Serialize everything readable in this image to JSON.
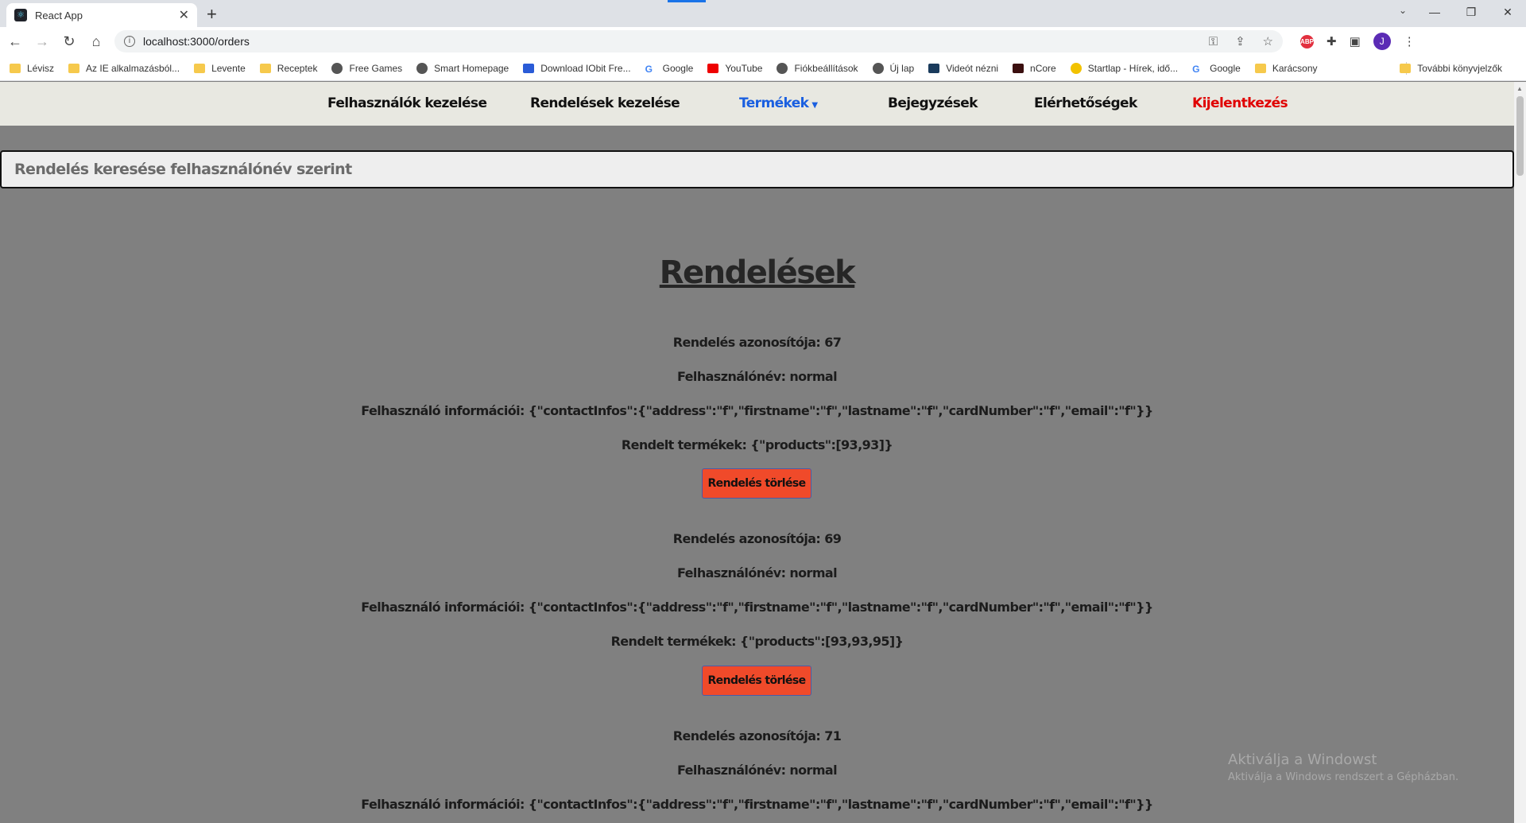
{
  "browser": {
    "tab_title": "React App",
    "tab_favicon": "react-icon",
    "url": "localhost:3000/orders",
    "bookmarks": [
      {
        "label": "Lévisz",
        "icon": "folder"
      },
      {
        "label": "Az IE alkalmazásból...",
        "icon": "folder"
      },
      {
        "label": "Levente",
        "icon": "folder"
      },
      {
        "label": "Receptek",
        "icon": "folder"
      },
      {
        "label": "Free Games",
        "icon": "globe"
      },
      {
        "label": "Smart Homepage",
        "icon": "globe"
      },
      {
        "label": "Download IObit Fre...",
        "icon": "blue"
      },
      {
        "label": "Google",
        "icon": "google"
      },
      {
        "label": "YouTube",
        "icon": "yt"
      },
      {
        "label": "Fiókbeállítások",
        "icon": "globe"
      },
      {
        "label": "Új lap",
        "icon": "globe"
      },
      {
        "label": "Videót nézni",
        "icon": "yah"
      },
      {
        "label": "nCore",
        "icon": "ncore"
      },
      {
        "label": "Startlap - Hírek, idő...",
        "icon": "start"
      },
      {
        "label": "Google",
        "icon": "google"
      },
      {
        "label": "Karácsony",
        "icon": "folder"
      }
    ],
    "other_bookmarks": "További könyvjelzők",
    "avatar_letter": "J"
  },
  "nav": {
    "users": "Felhasználók kezelése",
    "orders": "Rendelések kezelése",
    "products": "Termékek",
    "posts": "Bejegyzések",
    "contacts": "Elérhetőségek",
    "logout": "Kijelentkezés"
  },
  "search": {
    "placeholder": "Rendelés keresése felhasználónév szerint"
  },
  "main": {
    "title": "Rendelések",
    "delete_label": "Rendelés törlése",
    "orders": [
      {
        "id_line": "Rendelés azonosítója: 67",
        "user_line": "Felhasználónév: normal",
        "info_line": "Felhasználó információi: {\"contactInfos\":{\"address\":\"f\",\"firstname\":\"f\",\"lastname\":\"f\",\"cardNumber\":\"f\",\"email\":\"f\"}}",
        "products_line": "Rendelt termékek: {\"products\":[93,93]}"
      },
      {
        "id_line": "Rendelés azonosítója: 69",
        "user_line": "Felhasználónév: normal",
        "info_line": "Felhasználó információi: {\"contactInfos\":{\"address\":\"f\",\"firstname\":\"f\",\"lastname\":\"f\",\"cardNumber\":\"f\",\"email\":\"f\"}}",
        "products_line": "Rendelt termékek: {\"products\":[93,93,95]}"
      },
      {
        "id_line": "Rendelés azonosítója: 71",
        "user_line": "Felhasználónév: normal",
        "info_line": "Felhasználó információi: {\"contactInfos\":{\"address\":\"f\",\"firstname\":\"f\",\"lastname\":\"f\",\"cardNumber\":\"f\",\"email\":\"f\"}}"
      }
    ]
  },
  "watermark": {
    "line1": "Aktiválja a Windowst",
    "line2": "Aktiválja a Windows rendszert a Gépházban."
  },
  "colors": {
    "page_bg": "#808080",
    "nav_bg": "#e8e8e1",
    "active_nav": "#1a5fe0",
    "logout": "#e00000",
    "delete_button": "#f04a2a"
  }
}
